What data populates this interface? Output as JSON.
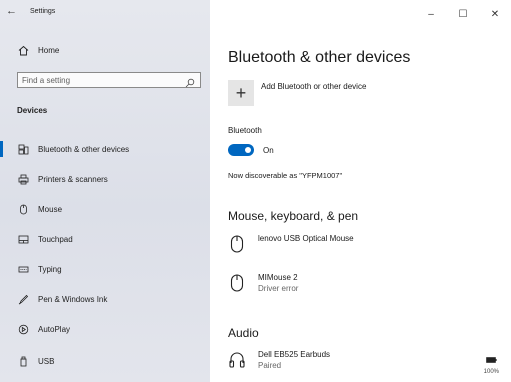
{
  "window": {
    "title": "Settings",
    "controls": {
      "minimize": "–",
      "maximize": "☐",
      "close": "✕"
    }
  },
  "sidebar": {
    "home_label": "Home",
    "search_placeholder": "Find a setting",
    "section_title": "Devices",
    "items": [
      {
        "label": "Bluetooth & other devices",
        "icon": "bluetooth-devices-icon",
        "active": true
      },
      {
        "label": "Printers & scanners",
        "icon": "printer-icon",
        "active": false
      },
      {
        "label": "Mouse",
        "icon": "mouse-icon",
        "active": false
      },
      {
        "label": "Touchpad",
        "icon": "touchpad-icon",
        "active": false
      },
      {
        "label": "Typing",
        "icon": "keyboard-icon",
        "active": false
      },
      {
        "label": "Pen & Windows Ink",
        "icon": "pen-icon",
        "active": false
      },
      {
        "label": "AutoPlay",
        "icon": "autoplay-icon",
        "active": false
      },
      {
        "label": "USB",
        "icon": "usb-icon",
        "active": false
      }
    ]
  },
  "main": {
    "title": "Bluetooth & other devices",
    "add_device_label": "Add Bluetooth or other device",
    "bluetooth_label": "Bluetooth",
    "bluetooth_state": "On",
    "discoverable_text": "Now discoverable as \"YFPM1007\"",
    "groups": [
      {
        "title": "Mouse, keyboard, & pen",
        "devices": [
          {
            "name": "lenovo USB Optical Mouse",
            "status": ""
          },
          {
            "name": "MIMouse 2",
            "status": "Driver error"
          }
        ]
      },
      {
        "title": "Audio",
        "devices": [
          {
            "name": "Dell EB525 Earbuds",
            "status": "Paired",
            "battery": "100%"
          }
        ]
      }
    ]
  },
  "colors": {
    "accent": "#0067c0",
    "sidebar_bg": "#dfe1e9"
  }
}
